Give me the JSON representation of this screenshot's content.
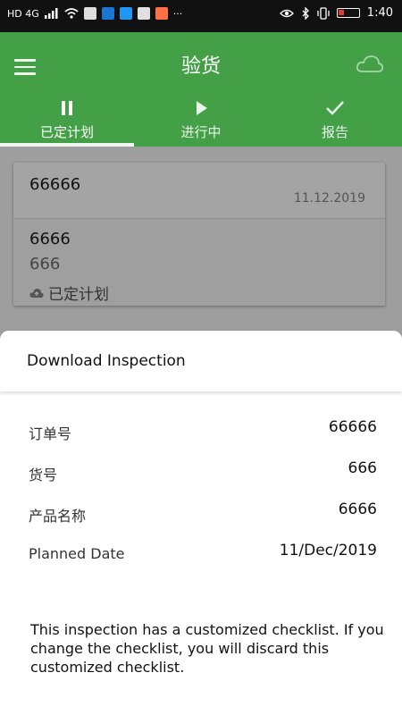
{
  "status_bar": {
    "left_text": "HD 4G",
    "time": "1:40"
  },
  "app_bar": {
    "title": "验货"
  },
  "tabs": [
    {
      "label": "已定计划",
      "icon": "pause-icon",
      "active": true
    },
    {
      "label": "进行中",
      "icon": "play-icon",
      "active": false
    },
    {
      "label": "报告",
      "icon": "check-icon",
      "active": false
    }
  ],
  "card": {
    "order_id": "66666",
    "date": "11.12.2019",
    "product_name": "6666",
    "item_number": "666",
    "status": "已定计划"
  },
  "sheet": {
    "title": "Download Inspection",
    "rows": [
      {
        "label": "订单号",
        "value": "66666"
      },
      {
        "label": "货号",
        "value": "666"
      },
      {
        "label": "产品名称",
        "value": "6666"
      },
      {
        "label": "Planned Date",
        "value": "11/Dec/2019"
      }
    ],
    "note": "This inspection has a customized checklist. If you change the checklist, you will discard this customized checklist."
  },
  "colors": {
    "primary": "#43a047",
    "status_bar": "#111111",
    "overlay": "#9e9e9e"
  }
}
